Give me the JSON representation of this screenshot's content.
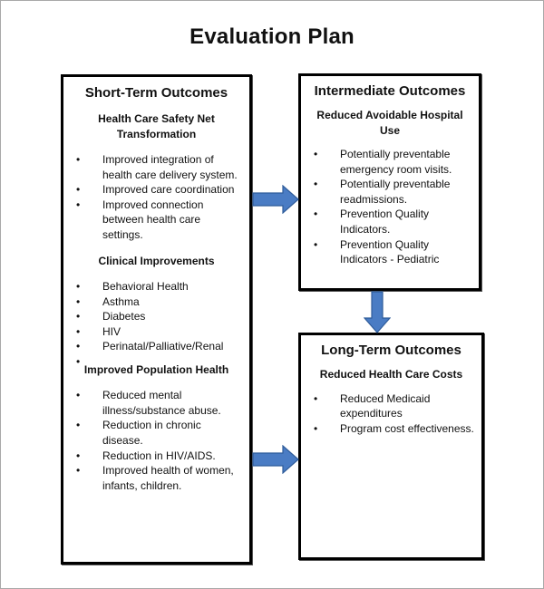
{
  "title": "Evaluation Plan",
  "colors": {
    "arrow_fill": "#4a7cc4",
    "arrow_stroke": "#2f5c9a",
    "box_border": "#000000"
  },
  "short_term": {
    "title": "Short-Term Outcomes",
    "sections": [
      {
        "heading": "Health Care Safety Net Transformation",
        "items": [
          "Improved integration of health care delivery system.",
          "Improved care coordination",
          "Improved connection between health care settings."
        ]
      },
      {
        "heading": "Clinical Improvements",
        "items": [
          "Behavioral Health",
          "Asthma",
          "Diabetes",
          "HIV",
          "Perinatal/Palliative/Renal",
          ""
        ]
      },
      {
        "heading": "Improved Population Health",
        "items": [
          "Reduced mental illness/substance abuse.",
          "Reduction in chronic disease.",
          "Reduction in HIV/AIDS.",
          "Improved health of women, infants, children."
        ]
      }
    ]
  },
  "intermediate": {
    "title": "Intermediate Outcomes",
    "heading": "Reduced Avoidable Hospital Use",
    "items": [
      "Potentially preventable emergency room visits.",
      "Potentially preventable readmissions.",
      "Prevention Quality Indicators.",
      "Prevention Quality Indicators - Pediatric"
    ]
  },
  "long_term": {
    "title": "Long-Term Outcomes",
    "heading": "Reduced Health Care Costs",
    "items": [
      "Reduced Medicaid expenditures",
      "Program cost effectiveness."
    ]
  },
  "bullet_glyph": "•"
}
